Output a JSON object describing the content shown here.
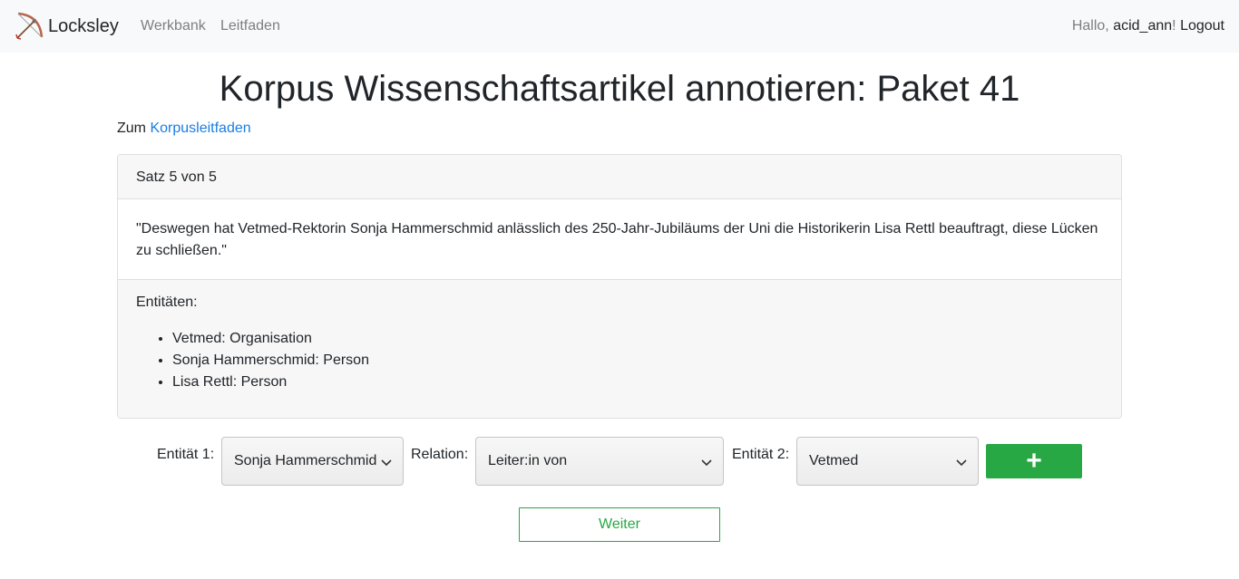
{
  "navbar": {
    "brand": "Locksley",
    "links": [
      "Werkbank",
      "Leitfaden"
    ],
    "greeting_prefix": "Hallo, ",
    "username": "acid_ann",
    "greeting_suffix": "!",
    "logout": "Logout"
  },
  "page": {
    "title": "Korpus Wissenschaftsartikel annotieren: Paket 41",
    "guide_prefix": "Zum",
    "guide_link": "Korpusleitfaden"
  },
  "card": {
    "header": "Satz 5 von 5",
    "sentence": "\"Deswegen hat Vetmed-Rektorin Sonja Hammerschmid anlässlich des 250-Jahr-Jubiläums der Uni die Historikerin Lisa Rettl beauftragt, diese Lücken zu schließen.\"",
    "entities_label": "Entitäten:",
    "entities": [
      "Vetmed: Organisation",
      "Sonja Hammerschmid: Person",
      "Lisa Rettl: Person"
    ]
  },
  "form": {
    "entity1_label": "Entität 1:",
    "entity1_value": "Sonja Hammerschmid",
    "relation_label": "Relation:",
    "relation_value": "Leiter:in von",
    "entity2_label": "Entität 2:",
    "entity2_value": "Vetmed",
    "add_label": "+",
    "next_label": "Weiter"
  },
  "colors": {
    "accent_green": "#28a745",
    "link_blue": "#1a7de3",
    "navbar_bg": "#f8f9fa"
  },
  "icons": [
    "bow-and-arrow-icon",
    "chevron-down-icon",
    "plus-icon"
  ]
}
